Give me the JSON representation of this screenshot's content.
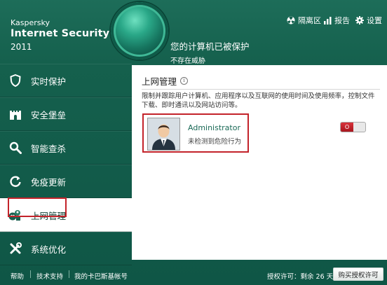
{
  "brand": {
    "line1": "Kaspersky",
    "line2": "Internet Security",
    "line3": "2011"
  },
  "status": {
    "title": "您的计算机已被保护",
    "subtitle": "不存在威胁"
  },
  "topbar": {
    "quarantine": "隔离区",
    "reports": "报告",
    "settings": "设置"
  },
  "sidebar": {
    "items": [
      {
        "label": "实时保护",
        "icon": "shield-icon"
      },
      {
        "label": "安全堡垒",
        "icon": "castle-icon"
      },
      {
        "label": "智能查杀",
        "icon": "magnifier-icon"
      },
      {
        "label": "免疫更新",
        "icon": "refresh-icon"
      },
      {
        "label": "上网管理",
        "icon": "parental-control-icon",
        "active": true
      },
      {
        "label": "系统优化",
        "icon": "tools-icon"
      }
    ]
  },
  "panel": {
    "title": "上网管理",
    "description": "限制并跟踪用户计算机、应用程序以及互联网的使用时间及使用频率，控制文件下载、即时通讯以及网站访问等。",
    "user": {
      "name": "Administrator",
      "status": "未检测到危险行为"
    },
    "toggle_label": "O"
  },
  "footer": {
    "help": "帮助",
    "support": "技术支持",
    "account": "我的卡巴斯基帐号",
    "license": "授权许可：剩余 26 天",
    "buy": "购买授权许可"
  },
  "colors": {
    "background": "#15604d",
    "accent": "#c3232a",
    "text_link": "#1b6a57"
  }
}
